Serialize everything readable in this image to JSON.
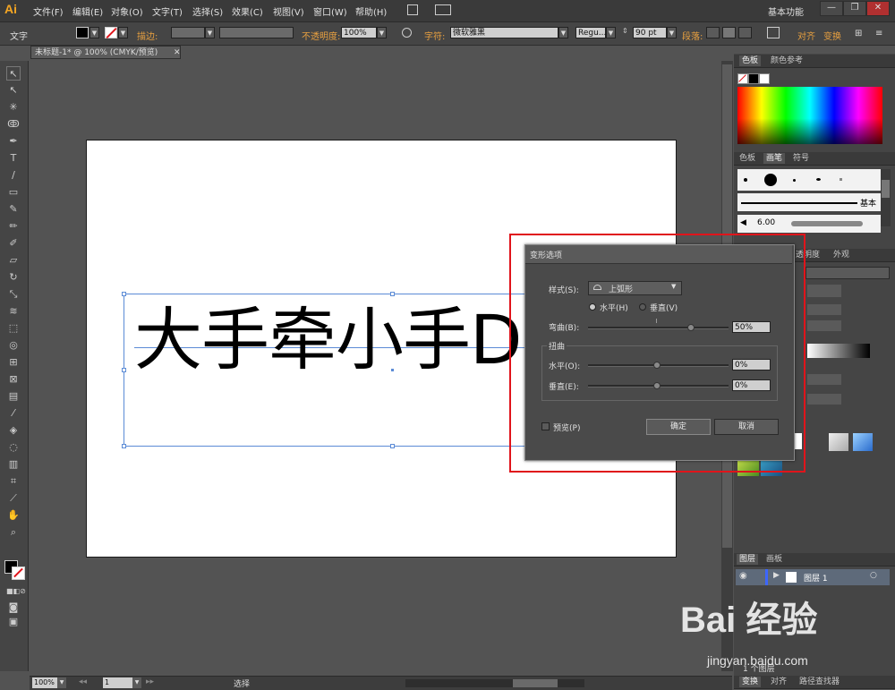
{
  "app": {
    "logo": "Ai"
  },
  "menu": [
    "文件(F)",
    "编辑(E)",
    "对象(O)",
    "文字(T)",
    "选择(S)",
    "效果(C)",
    "视图(V)",
    "窗口(W)",
    "帮助(H)"
  ],
  "workspace": "基本功能",
  "window_controls": {
    "minimize": "—",
    "restore": "❐",
    "close": "✕"
  },
  "control_bar": {
    "mode_label": "文字",
    "stroke_label": "描边:",
    "opacity_label": "不透明度:",
    "opacity_value": "100%",
    "char_label": "字符:",
    "font_value": "微软雅黑",
    "style_value": "Regu...",
    "size_value": "90 pt",
    "para_label": "段落:",
    "align_label": "对齐",
    "transform_label": "变换"
  },
  "document_tab": {
    "title": "未标题-1* @ 100% (CMYK/预览)",
    "close": "✕"
  },
  "canvas": {
    "art_text": "大手牵小手DS"
  },
  "status_bar": {
    "zoom": "100%",
    "page": "1",
    "tool": "选择"
  },
  "panels": {
    "color_tabs": [
      "色板",
      "颜色参考"
    ],
    "swatch_tabs": [
      "色板",
      "画笔",
      "符号"
    ],
    "brush_label": "基本",
    "brush_size": "6.00",
    "gradient_tabs": [
      "透明度",
      "外观"
    ],
    "layers_tabs": [
      "图层",
      "画板"
    ],
    "layer_name": "图层 1",
    "layer_count": "1 个图层",
    "bottom_tabs": [
      "变换",
      "对齐",
      "路径查找器"
    ]
  },
  "dialog": {
    "title": "变形选项",
    "style_label": "样式(S):",
    "style_value": "上弧形",
    "horizontal_label": "水平(H)",
    "vertical_label": "垂直(V)",
    "bend_label": "弯曲(B):",
    "bend_value": "50%",
    "distortion_label": "扭曲",
    "dist_h_label": "水平(O):",
    "dist_h_value": "0%",
    "dist_v_label": "垂直(E):",
    "dist_v_value": "0%",
    "preview_label": "预览(P)",
    "ok_label": "确定",
    "cancel_label": "取消"
  },
  "watermark": {
    "brand": "Bai  经验",
    "url": "jingyan.baidu.com"
  },
  "colors": {
    "highlight_box": "#e0141b",
    "selection": "#5b8bd6",
    "accent": "#e8a040"
  }
}
